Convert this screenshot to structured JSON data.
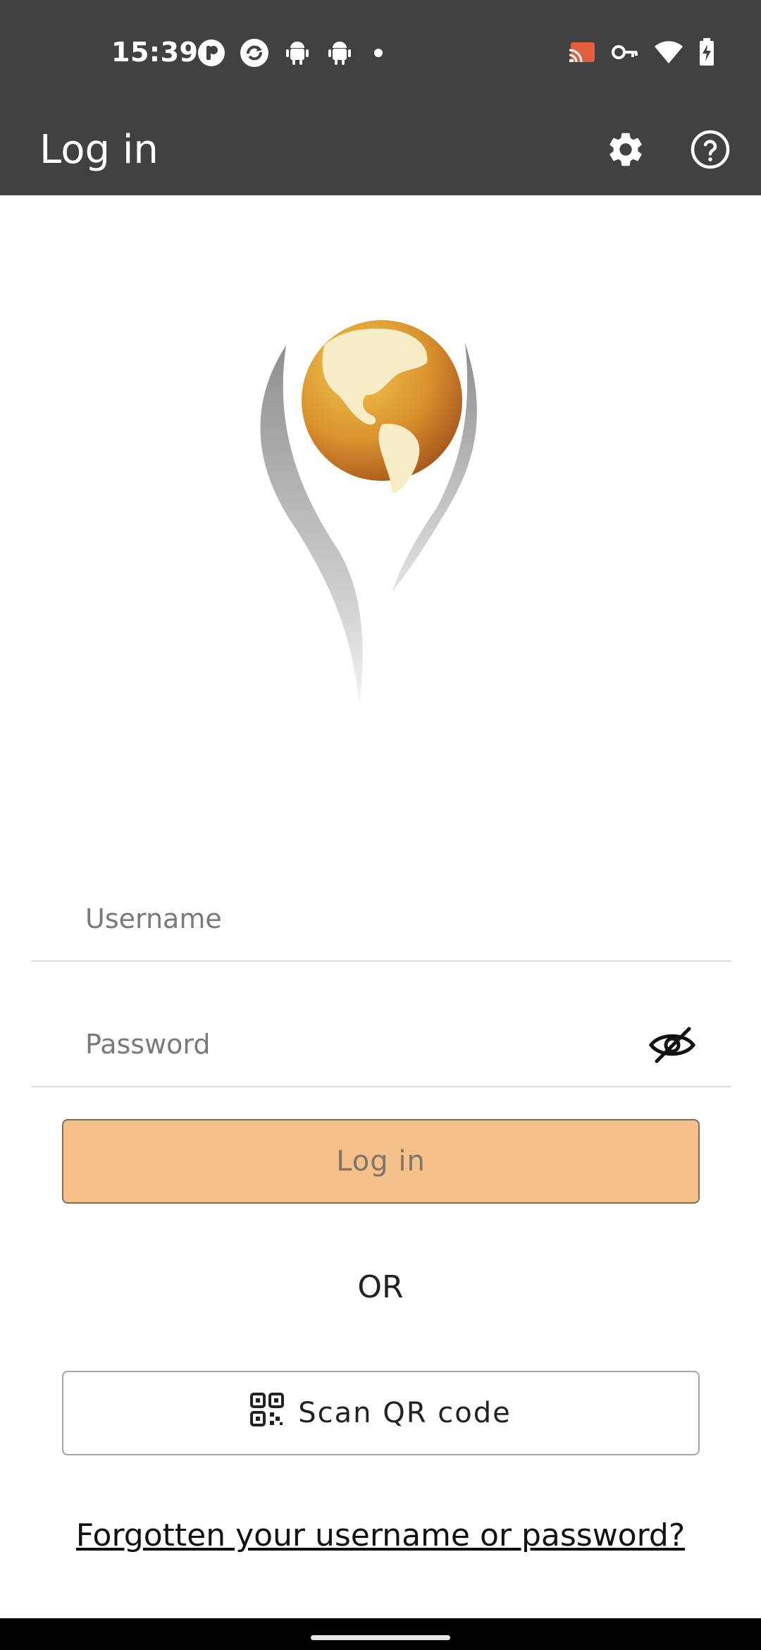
{
  "status_bar": {
    "time": "15:39",
    "left_icons": [
      "p-app-icon",
      "sync-app-icon",
      "android-icon",
      "android-icon",
      "dot-icon"
    ],
    "right_icons": [
      "cast-icon",
      "vpn-key-icon",
      "wifi-icon",
      "battery-charging-icon"
    ]
  },
  "app_bar": {
    "title": "Log in",
    "actions": [
      "gear-icon",
      "help-icon"
    ]
  },
  "form": {
    "username_placeholder": "Username",
    "username_value": "",
    "password_placeholder": "Password",
    "password_value": "",
    "login_label": "Log in",
    "or_label": "OR",
    "scan_qr_label": "Scan QR code",
    "forgot_label": "Forgotten your username or password?"
  },
  "colors": {
    "app_bar_bg": "#414141",
    "login_button_bg": "#f5c08a",
    "globe_gold": "#d9922f"
  }
}
